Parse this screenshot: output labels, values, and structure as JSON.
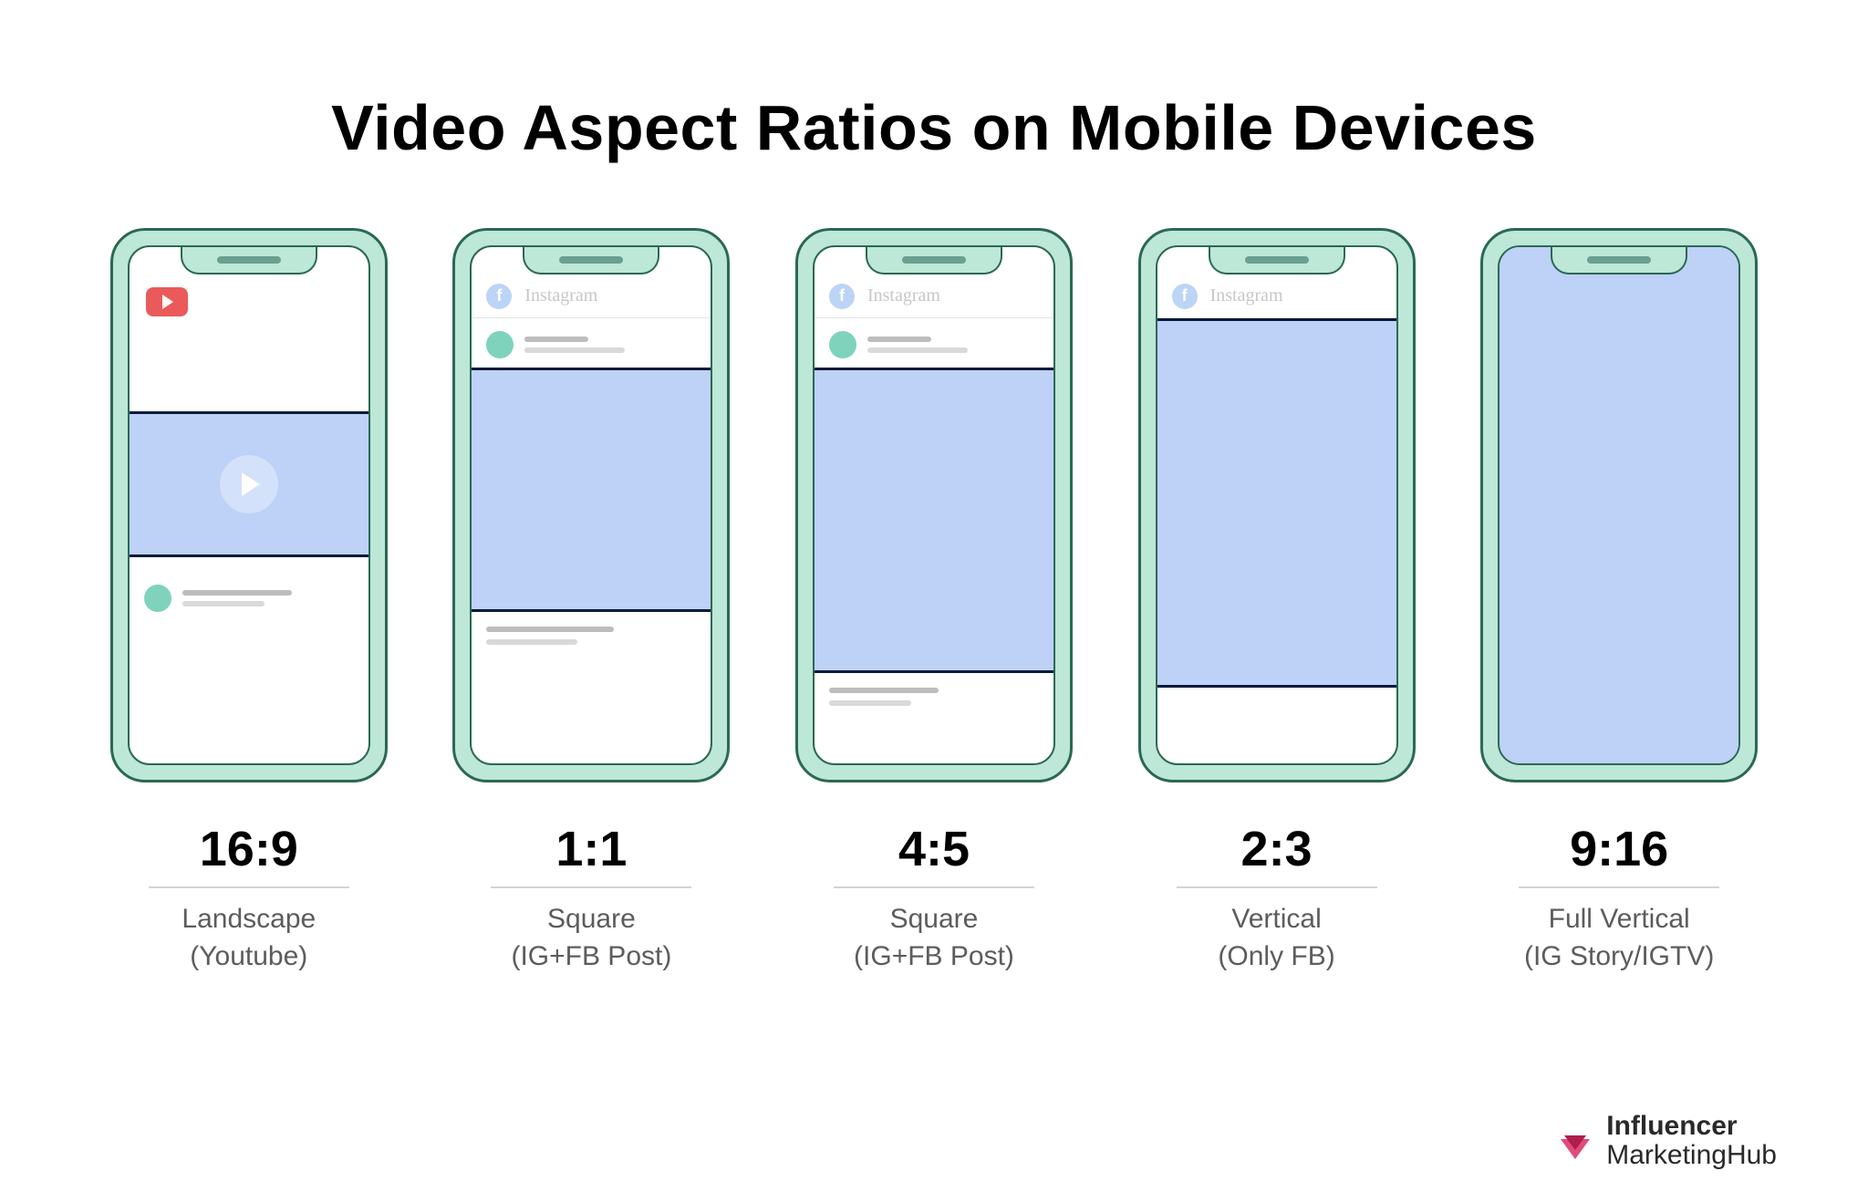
{
  "title": "Video Aspect Ratios on Mobile Devices",
  "columns": [
    {
      "ratio": "16:9",
      "desc_line1": "Landscape",
      "desc_line2": "(Youtube)"
    },
    {
      "ratio": "1:1",
      "desc_line1": "Square",
      "desc_line2": "(IG+FB Post)"
    },
    {
      "ratio": "4:5",
      "desc_line1": "Square",
      "desc_line2": "(IG+FB Post)"
    },
    {
      "ratio": "2:3",
      "desc_line1": "Vertical",
      "desc_line2": "(Only FB)"
    },
    {
      "ratio": "9:16",
      "desc_line1": "Full Vertical",
      "desc_line2": "(IG Story/IGTV)"
    }
  ],
  "app_labels": {
    "instagram": "Instagram",
    "facebook_letter": "f"
  },
  "brand": {
    "line1": "Influencer",
    "line2": "MarketingHub"
  }
}
